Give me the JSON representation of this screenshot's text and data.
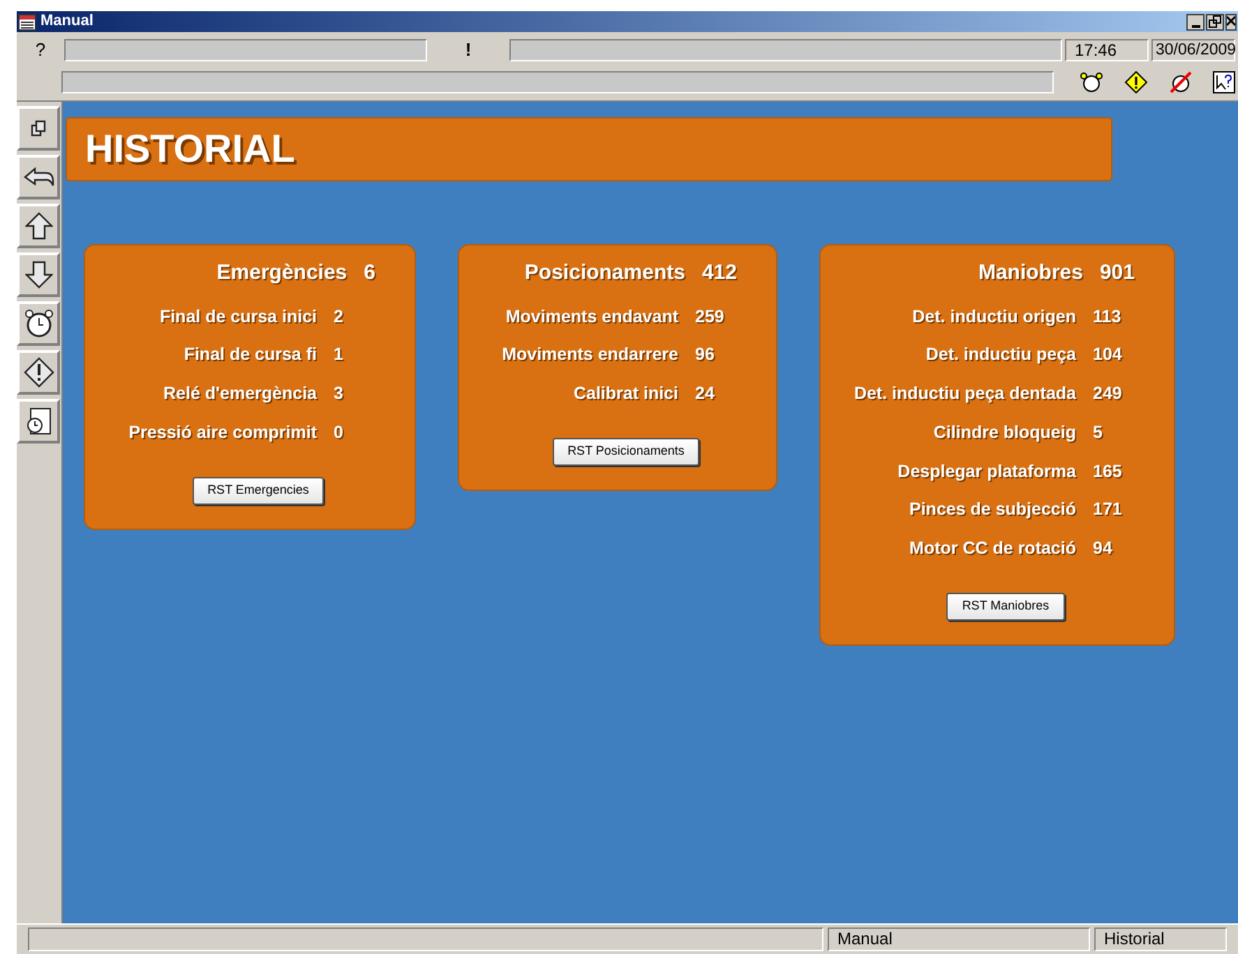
{
  "window": {
    "title": "Manual"
  },
  "toolbar": {
    "help_glyph": "?",
    "alert_glyph": "!",
    "time": "17:46",
    "date": "30/06/2009"
  },
  "header": {
    "title": "HISTORIAL"
  },
  "cards": [
    {
      "title": "Emergències",
      "total": "6",
      "rows": [
        {
          "label": "Final de cursa inici",
          "value": "2"
        },
        {
          "label": "Final de cursa fi",
          "value": "1"
        },
        {
          "label": "Relé d'emergència",
          "value": "3"
        },
        {
          "label": "Pressió aire comprimit",
          "value": "0"
        }
      ],
      "button": "RST Emergencies"
    },
    {
      "title": "Posicionaments",
      "total": "412",
      "rows": [
        {
          "label": "Moviments endavant",
          "value": "259"
        },
        {
          "label": "Moviments endarrere",
          "value": "96"
        },
        {
          "label": "Calibrat inici",
          "value": "24"
        }
      ],
      "button": "RST Posicionaments"
    },
    {
      "title": "Maniobres",
      "total": "901",
      "rows": [
        {
          "label": "Det. inductiu origen",
          "value": "113"
        },
        {
          "label": "Det. inductiu peça",
          "value": "104"
        },
        {
          "label": "Det. inductiu peça dentada",
          "value": "249"
        },
        {
          "label": "Cilindre bloqueig",
          "value": "5"
        },
        {
          "label": "Desplegar plataforma",
          "value": "165"
        },
        {
          "label": "Pinces de subjecció",
          "value": "171"
        },
        {
          "label": "Motor CC de rotació",
          "value": "94"
        }
      ],
      "button": "RST Maniobres"
    }
  ],
  "status_bar": {
    "mode": "Manual",
    "screen": "Historial"
  }
}
